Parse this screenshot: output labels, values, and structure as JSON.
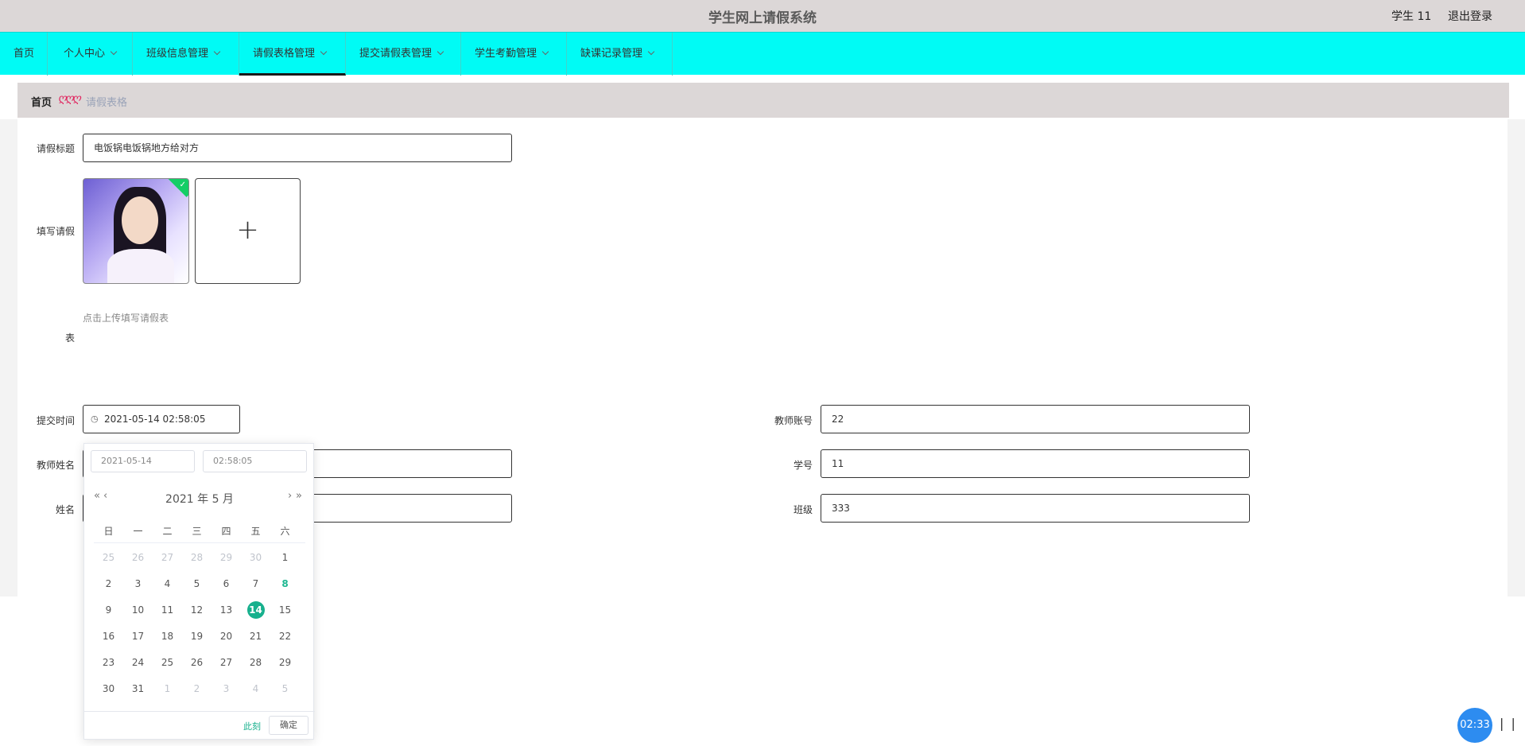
{
  "header": {
    "title": "学生网上请假系统",
    "user": "学生 11",
    "logout": "退出登录"
  },
  "nav": {
    "items": [
      {
        "label": "首页",
        "dropdown": false
      },
      {
        "label": "个人中心",
        "dropdown": true
      },
      {
        "label": "班级信息管理",
        "dropdown": true
      },
      {
        "label": "请假表格管理",
        "dropdown": true,
        "active": true
      },
      {
        "label": "提交请假表管理",
        "dropdown": true
      },
      {
        "label": "学生考勤管理",
        "dropdown": true
      },
      {
        "label": "缺课记录管理",
        "dropdown": true
      }
    ]
  },
  "breadcrumb": {
    "home": "首页",
    "separator": "ღღღ",
    "current": "请假表格"
  },
  "form": {
    "title_label": "请假标题",
    "title_value": "电饭锅电饭锅地方给对方",
    "upload_label_line1": "填写请假",
    "upload_label_line2": "表",
    "upload_tip": "点击上传填写请假表",
    "upload_add": "+",
    "submit_time_label": "提交时间",
    "submit_time_value": "2021-05-14 02:58:05",
    "teacher_account_label": "教师账号",
    "teacher_account_value": "22",
    "teacher_name_label": "教师姓名",
    "teacher_name_value": "",
    "student_no_label": "学号",
    "student_no_value": "11",
    "name_label": "姓名",
    "name_value": "",
    "class_label": "班级",
    "class_value": "333"
  },
  "picker": {
    "date_input": "2021-05-14",
    "time_input": "02:58:05",
    "prev_year": "«",
    "prev_month": "‹",
    "next_month": "›",
    "next_year": "»",
    "title": "2021 年 5 月",
    "weekdays": [
      "日",
      "一",
      "二",
      "三",
      "四",
      "五",
      "六"
    ],
    "days": [
      [
        "25",
        "26",
        "27",
        "28",
        "29",
        "30",
        "1"
      ],
      [
        "2",
        "3",
        "4",
        "5",
        "6",
        "7",
        "8"
      ],
      [
        "9",
        "10",
        "11",
        "12",
        "13",
        "14",
        "15"
      ],
      [
        "16",
        "17",
        "18",
        "19",
        "20",
        "21",
        "22"
      ],
      [
        "23",
        "24",
        "25",
        "26",
        "27",
        "28",
        "29"
      ],
      [
        "30",
        "31",
        "1",
        "2",
        "3",
        "4",
        "5"
      ]
    ],
    "today_day": "8",
    "selected_day": "14",
    "now_button": "此刻",
    "ok_button": "确定"
  },
  "timer": {
    "value": "02:33",
    "pause": "| |"
  },
  "colors": {
    "nav_bg": "#00fbf5",
    "header_bg": "#dcd7d7",
    "accent": "#17b08d"
  }
}
